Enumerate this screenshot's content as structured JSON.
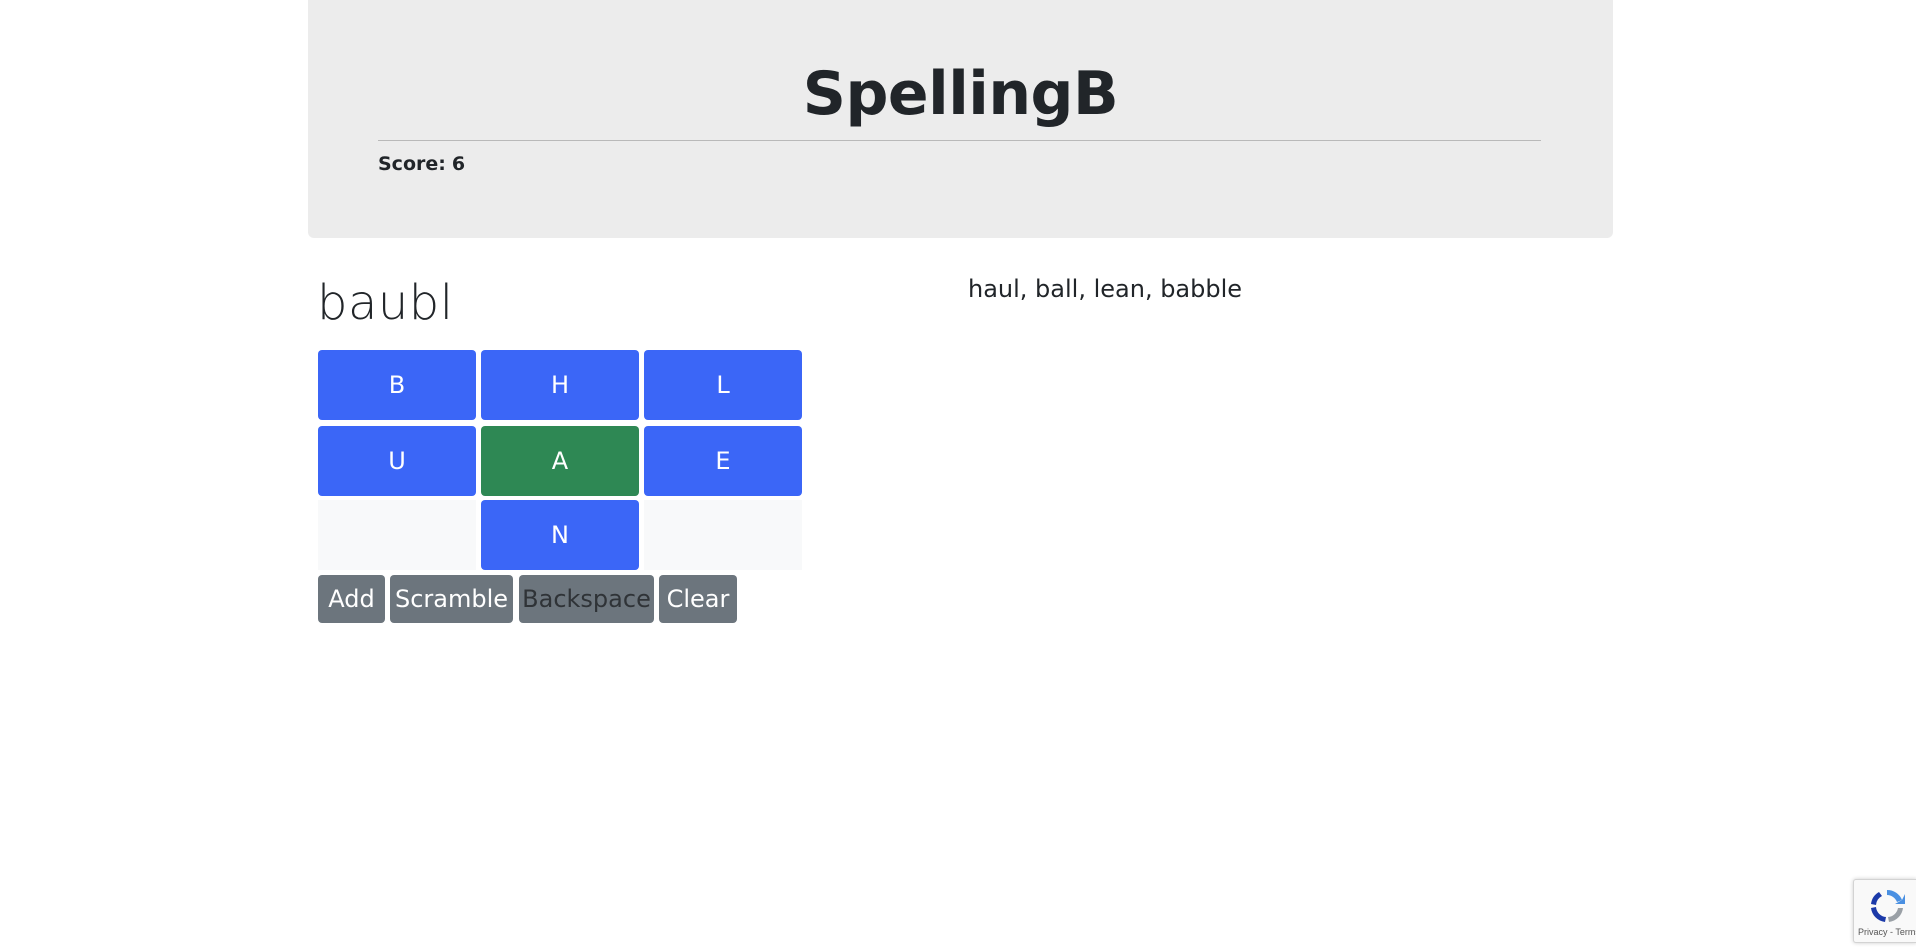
{
  "header": {
    "title": "SpellingB",
    "score_label": "Score:",
    "score_value": "6"
  },
  "current_word": "baubl",
  "found_words_text": "haul, ball, lean, babble",
  "tiles": {
    "row1": [
      "B",
      "H",
      "L"
    ],
    "row2": [
      "U",
      "A",
      "E"
    ],
    "row3_center": "N",
    "center_letter": "A"
  },
  "controls": {
    "add": "Add",
    "scramble": "Scramble",
    "backspace": "Backspace",
    "clear": "Clear"
  },
  "colors": {
    "tile": "#3b66f7",
    "center_tile": "#2e8854",
    "control_button": "#6c757d",
    "header_background": "#ececec"
  },
  "recaptcha": {
    "privacy": "Privacy",
    "terms": "Terms",
    "separator": "-"
  }
}
